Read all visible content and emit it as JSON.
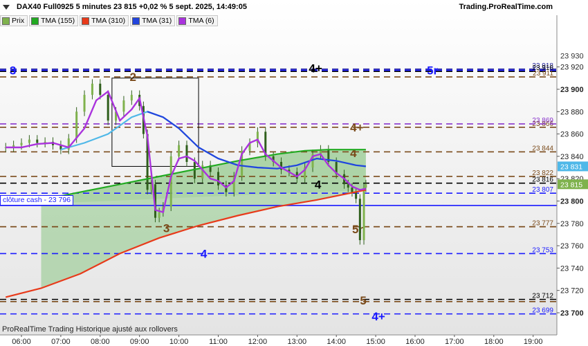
{
  "header": {
    "title": "DAX40 Full0925 5 minutes 23 815 +0,02 % 5 sept. 2025, 14:49:05",
    "site": "Trading.ProRealTime.com"
  },
  "legend": [
    {
      "label": "Prix",
      "color": "#7fb24d"
    },
    {
      "label": "TMA (155)",
      "color": "#22aa22"
    },
    {
      "label": "TMA (310)",
      "color": "#e83a1a"
    },
    {
      "label": "TMA (31)",
      "color": "#2244dd"
    },
    {
      "label": "TMA (6)",
      "color": "#aa33dd"
    }
  ],
  "cloture": "clôture cash - 23 796",
  "footer": "ProRealTime Trading  Historique ajusté aux rollovers",
  "chart_data": {
    "type": "line",
    "instrument": "DAX40 Full0925",
    "timeframe": "5 minutes",
    "ylim": [
      23690,
      23935
    ],
    "y_ticks": [
      23700,
      23720,
      23740,
      23760,
      23780,
      23800,
      23820,
      23840,
      23860,
      23880,
      23900,
      23920
    ],
    "y_tick_labels": [
      "23 700",
      "23 720",
      "23 740",
      "23 760",
      "23 780",
      "23 800",
      "23 820",
      "23 840",
      "23 860",
      "23 880",
      "23 900",
      "23 920"
    ],
    "y_top_label": "23 930",
    "x_ticks": [
      "06:00",
      "07:00",
      "08:00",
      "09:00",
      "10:00",
      "11:00",
      "12:00",
      "13:00",
      "14:00",
      "15:00",
      "16:00",
      "17:00",
      "18:00",
      "19:00"
    ],
    "x_range_hours": [
      5.6,
      19.6
    ],
    "last_price": "23 815",
    "last_price_value": 23815,
    "cloture_value": 23796,
    "levels": [
      {
        "value": 23918,
        "color": "#1a1a99",
        "label": "23 918",
        "tag": "3"
      },
      {
        "value": 23916,
        "color": "#000000",
        "label": "23 916",
        "tag": "4+"
      },
      {
        "value": 23917,
        "color": "#1a1aff",
        "label": "",
        "tag": "5r"
      },
      {
        "value": 23911,
        "color": "#7a4a1a",
        "label": "23 911",
        "tag": "2"
      },
      {
        "value": 23866,
        "color": "#7a4a1a",
        "label": "23 866",
        "tag": "4+"
      },
      {
        "value": 23869,
        "color": "#8833cc",
        "label": "23 869",
        "tag": ""
      },
      {
        "value": 23844,
        "color": "#7a4a1a",
        "label": "23 844",
        "tag": "4"
      },
      {
        "value": 23822,
        "color": "#7a4a1a",
        "label": "23 822",
        "tag": ""
      },
      {
        "value": 23816,
        "color": "#000000",
        "label": "23 816",
        "tag": "4"
      },
      {
        "value": 23807,
        "color": "#1a1aff",
        "label": "23 807",
        "tag": ""
      },
      {
        "value": 23777,
        "color": "#7a4a1a",
        "label": "23 777",
        "tag": "3"
      },
      {
        "value": 23777,
        "color": "#7a4a1a",
        "label": "",
        "tag": "5r"
      },
      {
        "value": 23753,
        "color": "#1a1aff",
        "label": "23 753",
        "tag": "4"
      },
      {
        "value": 23712,
        "color": "#000000",
        "label": "23 712",
        "tag": ""
      },
      {
        "value": 23710,
        "color": "#7a4a1a",
        "label": "",
        "tag": "5"
      },
      {
        "value": 23699,
        "color": "#1a1aff",
        "label": "23 699",
        "tag": "4+"
      }
    ],
    "price_tags": [
      {
        "value": 23831,
        "label": "23 831",
        "color": "#4fb8e8"
      },
      {
        "value": 23815,
        "label": "23 815",
        "color": "#7fb24d"
      }
    ],
    "series": [
      {
        "name": "TMA (155)",
        "color": "#22aa22",
        "x": [
          6.5,
          7.5,
          8.5,
          9.5,
          10.5,
          11.5,
          12.5,
          13.2,
          13.8,
          14.3,
          14.75
        ],
        "values": [
          23801,
          23808,
          23815,
          23822,
          23829,
          23836,
          23842,
          23845,
          23846,
          23846,
          23846
        ]
      },
      {
        "name": "TMA (310)",
        "color": "#e83a1a",
        "x": [
          5.6,
          6.5,
          7.5,
          8.5,
          9.5,
          10.5,
          11.5,
          12.5,
          13.5,
          14.2,
          14.75
        ],
        "values": [
          23714,
          23722,
          23735,
          23753,
          23767,
          23778,
          23787,
          23795,
          23801,
          23806,
          23810
        ]
      },
      {
        "name": "TMA (31)",
        "color": "#2244dd",
        "x": [
          7.0,
          7.6,
          8.2,
          8.8,
          9.2,
          9.6,
          10.0,
          10.5,
          11.0,
          11.5,
          12.0,
          12.5,
          13.0,
          13.5,
          14.0,
          14.5,
          14.75
        ],
        "values": [
          23846,
          23852,
          23860,
          23875,
          23880,
          23875,
          23865,
          23848,
          23838,
          23832,
          23830,
          23829,
          23832,
          23838,
          23836,
          23832,
          23831
        ]
      },
      {
        "name": "TMA (6)",
        "color": "#aa33dd",
        "x": [
          5.6,
          6.0,
          6.4,
          6.8,
          7.2,
          7.6,
          7.9,
          8.2,
          8.5,
          8.8,
          9.0,
          9.2,
          9.4,
          9.6,
          9.8,
          10.0,
          10.2,
          10.4,
          10.6,
          10.8,
          11.0,
          11.2,
          11.4,
          11.6,
          11.8,
          12.0,
          12.2,
          12.4,
          12.6,
          12.8,
          13.0,
          13.2,
          13.4,
          13.6,
          13.8,
          14.0,
          14.2,
          14.4,
          14.6,
          14.75
        ],
        "values": [
          23848,
          23848,
          23851,
          23852,
          23848,
          23865,
          23890,
          23898,
          23872,
          23882,
          23892,
          23858,
          23792,
          23790,
          23822,
          23838,
          23840,
          23836,
          23828,
          23820,
          23818,
          23812,
          23818,
          23842,
          23852,
          23855,
          23842,
          23836,
          23830,
          23826,
          23822,
          23828,
          23840,
          23842,
          23832,
          23825,
          23820,
          23813,
          23810,
          23811
        ]
      },
      {
        "name": "Prix",
        "x": [
          5.6,
          5.8,
          6.0,
          6.2,
          6.4,
          6.6,
          6.8,
          7.0,
          7.2,
          7.4,
          7.6,
          7.8,
          8.0,
          8.2,
          8.4,
          8.6,
          8.8,
          9.0,
          9.1,
          9.2,
          9.3,
          9.4,
          9.5,
          9.6,
          9.8,
          10.0,
          10.2,
          10.4,
          10.6,
          10.8,
          11.0,
          11.2,
          11.4,
          11.6,
          11.8,
          12.0,
          12.2,
          12.4,
          12.6,
          12.8,
          13.0,
          13.2,
          13.4,
          13.6,
          13.8,
          14.0,
          14.2,
          14.3,
          14.4,
          14.5,
          14.6,
          14.7,
          14.75
        ],
        "values": [
          23848,
          23850,
          23852,
          23855,
          23852,
          23853,
          23850,
          23846,
          23856,
          23880,
          23895,
          23905,
          23895,
          23872,
          23880,
          23890,
          23895,
          23885,
          23860,
          23810,
          23815,
          23785,
          23790,
          23795,
          23840,
          23850,
          23835,
          23820,
          23832,
          23826,
          23814,
          23808,
          23822,
          23845,
          23852,
          23862,
          23840,
          23835,
          23828,
          23826,
          23820,
          23830,
          23842,
          23846,
          23835,
          23824,
          23815,
          23812,
          23808,
          23802,
          23765,
          23812,
          23815
        ]
      }
    ],
    "box": {
      "x0": 8.3,
      "x1": 10.5,
      "y0": 23910,
      "y1": 23831
    },
    "grid": false
  }
}
